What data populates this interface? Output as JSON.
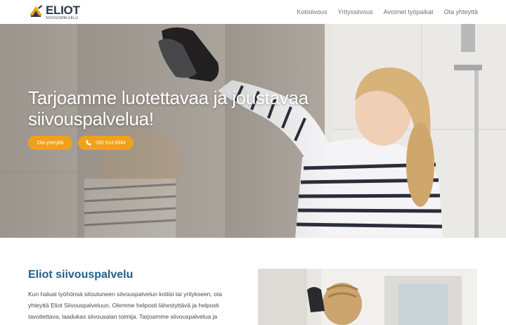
{
  "brand": {
    "name": "ELIOT",
    "tagline": "SIIVOUSPALVELU"
  },
  "nav": {
    "items": [
      {
        "label": "Kotisiivous"
      },
      {
        "label": "Yrityssiivous"
      },
      {
        "label": "Avoimet työpaikat"
      },
      {
        "label": "Ota yhteyttä"
      }
    ]
  },
  "hero": {
    "title": "Tarjoamme luotettavaa ja joustavaa siivouspalvelua!",
    "contact_button": "Ota yhteyttä",
    "phone_button": "050 514 8944",
    "phone_icon": "phone-icon"
  },
  "intro": {
    "title": "Eliot siivouspalvelu",
    "text": "Kun haluat työhönsä sitoutuneen siivouspalvelun kotiisi tai yritykseen, ota yhteyttä Eliot Siivouspalveluun. Olemme helposti lähestyttävä ja helposti tavoitettava, laadukas siivousalan toimija. Tarjoamme siivouspalvelua ja"
  },
  "colors": {
    "accent": "#f0a11b",
    "heading": "#1f5f8b",
    "logo": "#2b3a4a"
  }
}
